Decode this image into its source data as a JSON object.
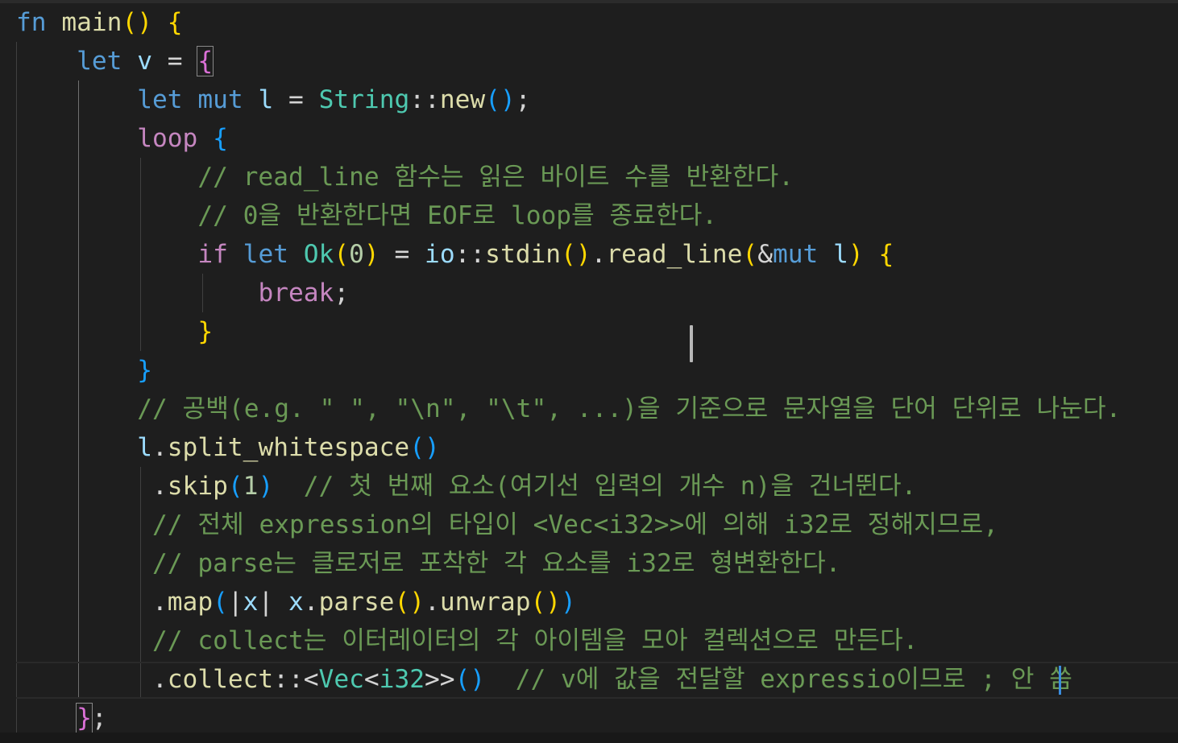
{
  "editor": {
    "language": "rust",
    "lines": [
      {
        "tokens": [
          [
            "kw",
            "fn"
          ],
          [
            "op",
            " "
          ],
          [
            "fn",
            "main"
          ],
          [
            "b1",
            "()"
          ],
          [
            "op",
            " "
          ],
          [
            "b1",
            "{"
          ]
        ]
      },
      {
        "tokens": [
          [
            "op",
            "    "
          ],
          [
            "kw",
            "let"
          ],
          [
            "op",
            " "
          ],
          [
            "var",
            "v"
          ],
          [
            "op",
            " = "
          ],
          [
            "b2",
            "{"
          ]
        ]
      },
      {
        "tokens": [
          [
            "op",
            "        "
          ],
          [
            "kw",
            "let"
          ],
          [
            "op",
            " "
          ],
          [
            "kw",
            "mut"
          ],
          [
            "op",
            " "
          ],
          [
            "var",
            "l"
          ],
          [
            "op",
            " = "
          ],
          [
            "ty",
            "String"
          ],
          [
            "op",
            "::"
          ],
          [
            "fn",
            "new"
          ],
          [
            "b3",
            "()"
          ],
          [
            "op",
            ";"
          ]
        ]
      },
      {
        "tokens": [
          [
            "op",
            "        "
          ],
          [
            "ctrl",
            "loop"
          ],
          [
            "op",
            " "
          ],
          [
            "b3",
            "{"
          ]
        ]
      },
      {
        "tokens": [
          [
            "op",
            "            "
          ],
          [
            "cm",
            "// read_line 함수는 읽은 바이트 수를 반환한다."
          ]
        ]
      },
      {
        "tokens": [
          [
            "op",
            "            "
          ],
          [
            "cm",
            "// 0을 반환한다면 EOF로 loop를 종료한다."
          ]
        ]
      },
      {
        "tokens": [
          [
            "op",
            "            "
          ],
          [
            "ctrl",
            "if"
          ],
          [
            "op",
            " "
          ],
          [
            "kw",
            "let"
          ],
          [
            "op",
            " "
          ],
          [
            "ty",
            "Ok"
          ],
          [
            "b1",
            "("
          ],
          [
            "num",
            "0"
          ],
          [
            "b1",
            ")"
          ],
          [
            "op",
            " = "
          ],
          [
            "var",
            "io"
          ],
          [
            "op",
            "::"
          ],
          [
            "fn",
            "stdin"
          ],
          [
            "b1",
            "()"
          ],
          [
            "op",
            "."
          ],
          [
            "fn",
            "read_line"
          ],
          [
            "b1",
            "("
          ],
          [
            "op",
            "&"
          ],
          [
            "kw",
            "mut"
          ],
          [
            "op",
            " "
          ],
          [
            "var",
            "l"
          ],
          [
            "b1",
            ")"
          ],
          [
            "op",
            " "
          ],
          [
            "b1",
            "{"
          ]
        ]
      },
      {
        "tokens": [
          [
            "op",
            "                "
          ],
          [
            "ctrl",
            "break"
          ],
          [
            "op",
            ";"
          ]
        ]
      },
      {
        "tokens": [
          [
            "op",
            "            "
          ],
          [
            "b1",
            "}"
          ]
        ]
      },
      {
        "tokens": [
          [
            "op",
            "        "
          ],
          [
            "b3",
            "}"
          ]
        ]
      },
      {
        "tokens": [
          [
            "op",
            "        "
          ],
          [
            "cm",
            "// 공백(e.g. \" \", \"\\n\", \"\\t\", ...)을 기준으로 문자열을 단어 단위로 나눈다."
          ]
        ]
      },
      {
        "tokens": [
          [
            "op",
            "        "
          ],
          [
            "var",
            "l"
          ],
          [
            "op",
            "."
          ],
          [
            "fn",
            "split_whitespace"
          ],
          [
            "b3",
            "()"
          ]
        ]
      },
      {
        "tokens": [
          [
            "op",
            "         ."
          ],
          [
            "fn",
            "skip"
          ],
          [
            "b3",
            "("
          ],
          [
            "num",
            "1"
          ],
          [
            "b3",
            ")"
          ],
          [
            "op",
            "  "
          ],
          [
            "cm",
            "// 첫 번째 요소(여기선 입력의 개수 n)을 건너뛴다."
          ]
        ]
      },
      {
        "tokens": [
          [
            "op",
            "         "
          ],
          [
            "cm",
            "// 전체 expression의 타입이 <Vec<i32>>에 의해 i32로 정해지므로,"
          ]
        ]
      },
      {
        "tokens": [
          [
            "op",
            "         "
          ],
          [
            "cm",
            "// parse는 클로저로 포착한 각 요소를 i32로 형변환한다."
          ]
        ]
      },
      {
        "tokens": [
          [
            "op",
            "         ."
          ],
          [
            "fn",
            "map"
          ],
          [
            "b3",
            "("
          ],
          [
            "op",
            "|"
          ],
          [
            "var",
            "x"
          ],
          [
            "op",
            "| "
          ],
          [
            "var",
            "x"
          ],
          [
            "op",
            "."
          ],
          [
            "fn",
            "parse"
          ],
          [
            "b1",
            "()"
          ],
          [
            "op",
            "."
          ],
          [
            "fn",
            "unwrap"
          ],
          [
            "b1",
            "()"
          ],
          [
            "b3",
            ")"
          ]
        ]
      },
      {
        "tokens": [
          [
            "op",
            "         "
          ],
          [
            "cm",
            "// collect는 이터레이터의 각 아이템을 모아 컬렉션으로 만든다."
          ]
        ]
      },
      {
        "tokens": [
          [
            "op",
            "         ."
          ],
          [
            "fn",
            "collect"
          ],
          [
            "op",
            "::<"
          ],
          [
            "ty",
            "Vec"
          ],
          [
            "op",
            "<"
          ],
          [
            "ty",
            "i32"
          ],
          [
            "op",
            ">>"
          ],
          [
            "b3",
            "()"
          ],
          [
            "op",
            "  "
          ],
          [
            "cm",
            "// v에 값을 전달할 expressio이므로 ; 안 씀"
          ]
        ]
      },
      {
        "tokens": [
          [
            "op",
            "    "
          ],
          [
            "b2",
            "}"
          ],
          [
            "op",
            ";"
          ]
        ]
      }
    ]
  }
}
